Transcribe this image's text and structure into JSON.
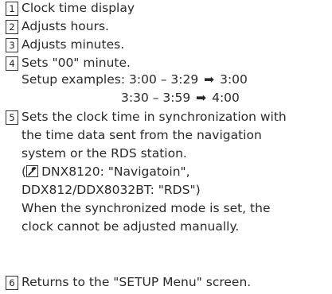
{
  "items": [
    {
      "num": "1",
      "text": "Clock time display"
    },
    {
      "num": "2",
      "text": "Adjusts hours."
    },
    {
      "num": "3",
      "text": "Adjusts minutes."
    },
    {
      "num": "4",
      "text": "Sets \"00\" minute.",
      "setup_label": "Setup examples:",
      "ex1_range": "3:00 – 3:29",
      "ex1_result": "3:00",
      "ex2_range": "3:30 – 3:59",
      "ex2_result": "4:00"
    },
    {
      "num": "5",
      "lines": [
        "Sets the clock time in synchronization with",
        "the time data sent from the navigation",
        "system or the RDS station."
      ],
      "paren_open": "(",
      "ref1": "DNX8120: \"Navigatoin\",",
      "ref2": "DDX812/DDX8032BT: \"RDS\")",
      "note1": "When the synchronized mode is set, the",
      "note2": "clock cannot be adjusted manually."
    },
    {
      "num": "6",
      "text": "Returns to the \"SETUP Menu\" screen."
    }
  ],
  "arrow_glyph": "➡",
  "icons": {
    "reference": "wrench-icon"
  }
}
